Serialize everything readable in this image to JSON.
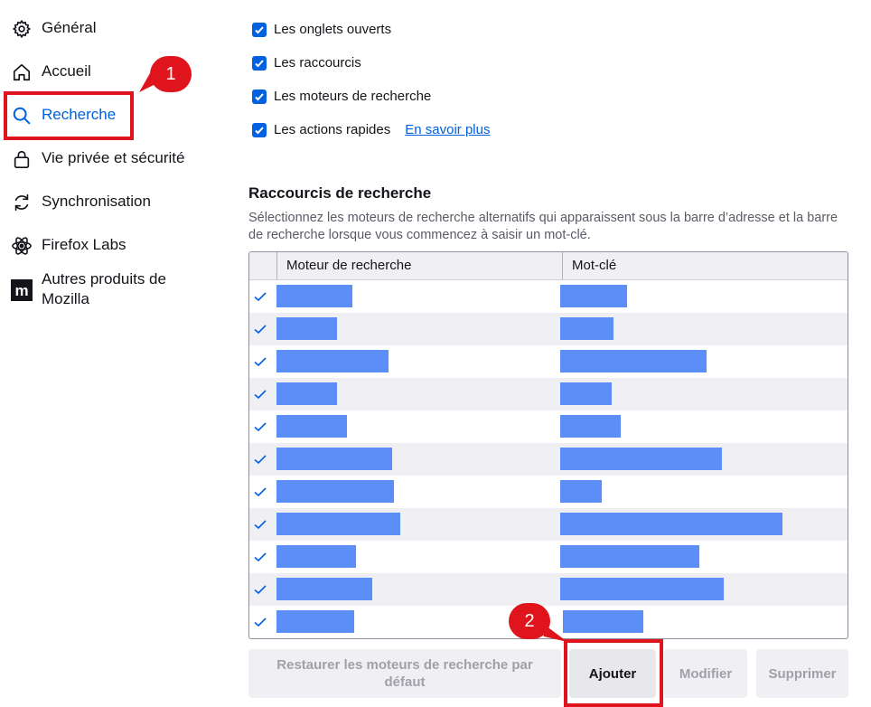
{
  "sidebar": {
    "items": [
      {
        "label": "Général",
        "icon": "gear-icon"
      },
      {
        "label": "Accueil",
        "icon": "home-icon"
      },
      {
        "label": "Recherche",
        "icon": "search-icon"
      },
      {
        "label": "Vie privée et sécurité",
        "icon": "lock-icon"
      },
      {
        "label": "Synchronisation",
        "icon": "sync-icon"
      },
      {
        "label": "Firefox Labs",
        "icon": "atom-icon"
      },
      {
        "label": "Autres produits de Mozilla",
        "icon": "mozilla-logo-icon"
      }
    ]
  },
  "annotations": {
    "callout_1": "1",
    "callout_2": "2"
  },
  "suggestions": {
    "open_tabs": "Les onglets ouverts",
    "shortcuts": "Les raccourcis",
    "engines": "Les moteurs de recherche",
    "quick_actions": "Les actions rapides",
    "learn_more": "En savoir plus"
  },
  "shortcuts_section": {
    "title": "Raccourcis de recherche",
    "description": "Sélectionnez les moteurs de recherche alternatifs qui apparaissent sous la barre d’adresse et la barre de recherche lorsque vous commencez à saisir un mot-clé."
  },
  "table": {
    "col_engine": "Moteur de recherche",
    "col_keyword": "Mot-clé",
    "rows": 11
  },
  "buttons": {
    "restore": "Restaurer les moteurs de recherche par défaut",
    "add": "Ajouter",
    "edit": "Modifier",
    "remove": "Supprimer"
  },
  "colors": {
    "accent": "#0061e0",
    "annotation": "#e0141c",
    "redaction": "#5b8ef7"
  }
}
